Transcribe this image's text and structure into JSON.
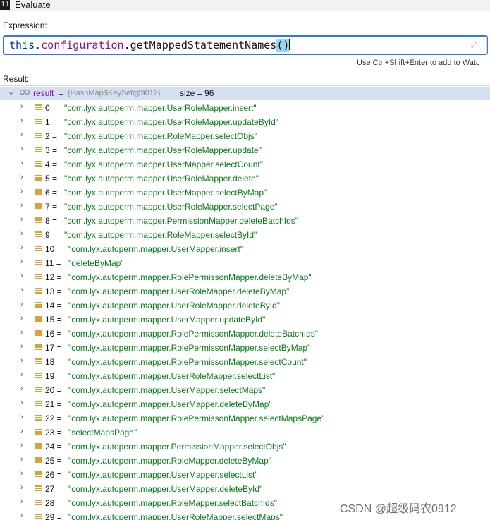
{
  "window": {
    "title": "Evaluate",
    "app_icon": "intellij-idea-icon"
  },
  "expression": {
    "label": "Expression:",
    "value": "this.configuration.getMappedStatementNames()",
    "hint": "Use Ctrl+Shift+Enter to add to Watc"
  },
  "result": {
    "label": "Result:",
    "root": {
      "name": "result",
      "eq": "=",
      "type": "{HashMap$KeySet@9012}",
      "size": "size = 96"
    },
    "items": [
      {
        "index": "0",
        "value": "\"com.lyx.autoperm.mapper.UserRoleMapper.insert\""
      },
      {
        "index": "1",
        "value": "\"com.lyx.autoperm.mapper.UserRoleMapper.updateById\""
      },
      {
        "index": "2",
        "value": "\"com.lyx.autoperm.mapper.RoleMapper.selectObjs\""
      },
      {
        "index": "3",
        "value": "\"com.lyx.autoperm.mapper.UserRoleMapper.update\""
      },
      {
        "index": "4",
        "value": "\"com.lyx.autoperm.mapper.UserMapper.selectCount\""
      },
      {
        "index": "5",
        "value": "\"com.lyx.autoperm.mapper.UserRoleMapper.delete\""
      },
      {
        "index": "6",
        "value": "\"com.lyx.autoperm.mapper.UserMapper.selectByMap\""
      },
      {
        "index": "7",
        "value": "\"com.lyx.autoperm.mapper.UserRoleMapper.selectPage\""
      },
      {
        "index": "8",
        "value": "\"com.lyx.autoperm.mapper.PermissionMapper.deleteBatchIds\""
      },
      {
        "index": "9",
        "value": "\"com.lyx.autoperm.mapper.RoleMapper.selectById\""
      },
      {
        "index": "10",
        "value": "\"com.lyx.autoperm.mapper.UserMapper.insert\""
      },
      {
        "index": "11",
        "value": "\"deleteByMap\""
      },
      {
        "index": "12",
        "value": "\"com.lyx.autoperm.mapper.RolePermissonMapper.deleteByMap\""
      },
      {
        "index": "13",
        "value": "\"com.lyx.autoperm.mapper.UserRoleMapper.deleteByMap\""
      },
      {
        "index": "14",
        "value": "\"com.lyx.autoperm.mapper.UserRoleMapper.deleteById\""
      },
      {
        "index": "15",
        "value": "\"com.lyx.autoperm.mapper.UserMapper.updateById\""
      },
      {
        "index": "16",
        "value": "\"com.lyx.autoperm.mapper.RolePermissonMapper.deleteBatchIds\""
      },
      {
        "index": "17",
        "value": "\"com.lyx.autoperm.mapper.RolePermissonMapper.selectByMap\""
      },
      {
        "index": "18",
        "value": "\"com.lyx.autoperm.mapper.RolePermissonMapper.selectCount\""
      },
      {
        "index": "19",
        "value": "\"com.lyx.autoperm.mapper.UserRoleMapper.selectList\""
      },
      {
        "index": "20",
        "value": "\"com.lyx.autoperm.mapper.UserMapper.selectMaps\""
      },
      {
        "index": "21",
        "value": "\"com.lyx.autoperm.mapper.UserMapper.deleteByMap\""
      },
      {
        "index": "22",
        "value": "\"com.lyx.autoperm.mapper.RolePermissonMapper.selectMapsPage\""
      },
      {
        "index": "23",
        "value": "\"selectMapsPage\""
      },
      {
        "index": "24",
        "value": "\"com.lyx.autoperm.mapper.PermissionMapper.selectObjs\""
      },
      {
        "index": "25",
        "value": "\"com.lyx.autoperm.mapper.RoleMapper.deleteByMap\""
      },
      {
        "index": "26",
        "value": "\"com.lyx.autoperm.mapper.UserMapper.selectList\""
      },
      {
        "index": "27",
        "value": "\"com.lyx.autoperm.mapper.UserMapper.deleteById\""
      },
      {
        "index": "28",
        "value": "\"com.lyx.autoperm.mapper.RoleMapper.selectBatchIds\""
      },
      {
        "index": "29",
        "value": "\"com.lyx.autoperm.mapper.UserRoleMapper.selectMaps\""
      }
    ]
  },
  "watermark": "CSDN @超级码农0912",
  "colors": {
    "selection": "#d5e1f2",
    "string": "#067d17",
    "focus_border": "#3574f0"
  }
}
